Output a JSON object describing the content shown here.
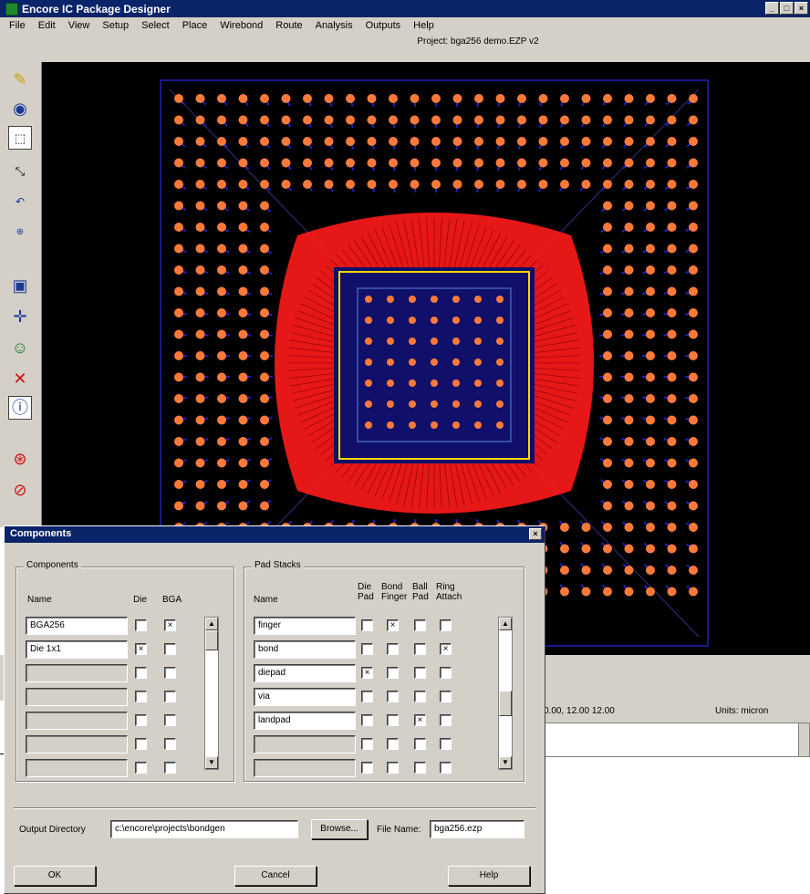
{
  "window": {
    "title": "Encore IC Package Designer",
    "buttons": [
      "_",
      "□",
      "×"
    ]
  },
  "menu": [
    "File",
    "Edit",
    "View",
    "Setup",
    "Select",
    "Place",
    "Wirebond",
    "Route",
    "Analysis",
    "Outputs",
    "Help"
  ],
  "file_path": "Project: bga256 demo.EZP v2",
  "status": {
    "coords": "0.00, 12.00 12.00",
    "units": "Units: micron"
  },
  "dialog": {
    "title": "Components",
    "close": "×",
    "components_group": {
      "title": "Components",
      "col_name": "Name",
      "col_die": "Die",
      "col_bga": "BGA",
      "rows": [
        {
          "name": "BGA256",
          "die": "",
          "bga": "×"
        },
        {
          "name": "Die 1x1",
          "die": "×",
          "bga": ""
        },
        {
          "name": "",
          "die": "",
          "bga": ""
        },
        {
          "name": "",
          "die": "",
          "bga": ""
        },
        {
          "name": "",
          "die": "",
          "bga": ""
        },
        {
          "name": "",
          "die": "",
          "bga": ""
        },
        {
          "name": "",
          "die": "",
          "bga": ""
        }
      ]
    },
    "padstacks_group": {
      "title": "Pad Stacks",
      "col_name": "Name",
      "col_die": "Die\nPad",
      "col_bond": "Bond\nFinger",
      "col_ball": "Ball\nPad",
      "col_ring": "Ring\nAttach",
      "rows": [
        {
          "name": "finger",
          "die": "",
          "bond": "×",
          "ball": "",
          "ring": ""
        },
        {
          "name": "bond",
          "die": "",
          "bond": "",
          "ball": "",
          "ring": "×"
        },
        {
          "name": "diepad",
          "die": "×",
          "bond": "",
          "ball": "",
          "ring": ""
        },
        {
          "name": "via",
          "die": "",
          "bond": "",
          "ball": "",
          "ring": ""
        },
        {
          "name": "landpad",
          "die": "",
          "bond": "",
          "ball": "×",
          "ring": ""
        },
        {
          "name": "",
          "die": "",
          "bond": "",
          "ball": "",
          "ring": ""
        },
        {
          "name": "",
          "die": "",
          "bond": "",
          "ball": "",
          "ring": ""
        }
      ]
    },
    "output_dir_label": "Output Directory",
    "output_dir_value": "c:\\encore\\projects\\bondgen",
    "browse_label": "Browse...",
    "file_name_label": "File Name:",
    "file_name_value": "bga256.ezp",
    "ok_label": "OK",
    "cancel_label": "Cancel",
    "help_label": "Help"
  },
  "toolbar_icons": [
    "pencil-icon",
    "globe-icon",
    "select-box-icon",
    "move-icon",
    "undo-icon",
    "zoom-icon",
    "component-icon",
    "route-icon",
    "wirebond-icon",
    "delete-icon",
    "info-icon",
    "stop-icon",
    "cancel-icon"
  ],
  "colors": {
    "titlebar": "#0a246a",
    "chrome": "#d4d0c8",
    "canvas": "#000000",
    "pad": "#ff7a3a",
    "wire": "#ff1a1a",
    "trace": "#2020c0",
    "die_outline": "#ffd700"
  }
}
